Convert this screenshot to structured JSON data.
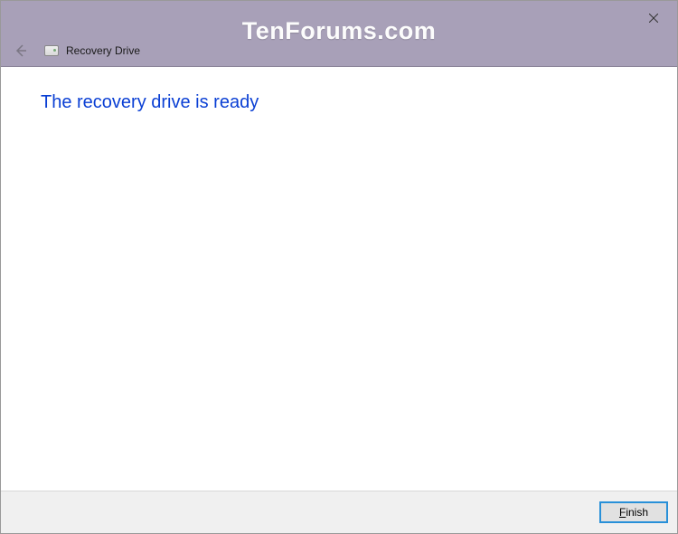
{
  "titlebar": {
    "close_label": "Close"
  },
  "header": {
    "title": "Recovery Drive"
  },
  "content": {
    "heading": "The recovery drive is ready"
  },
  "footer": {
    "finish_label": "Finish",
    "finish_accel": "F"
  },
  "watermark": {
    "text": "TenForums.com"
  }
}
